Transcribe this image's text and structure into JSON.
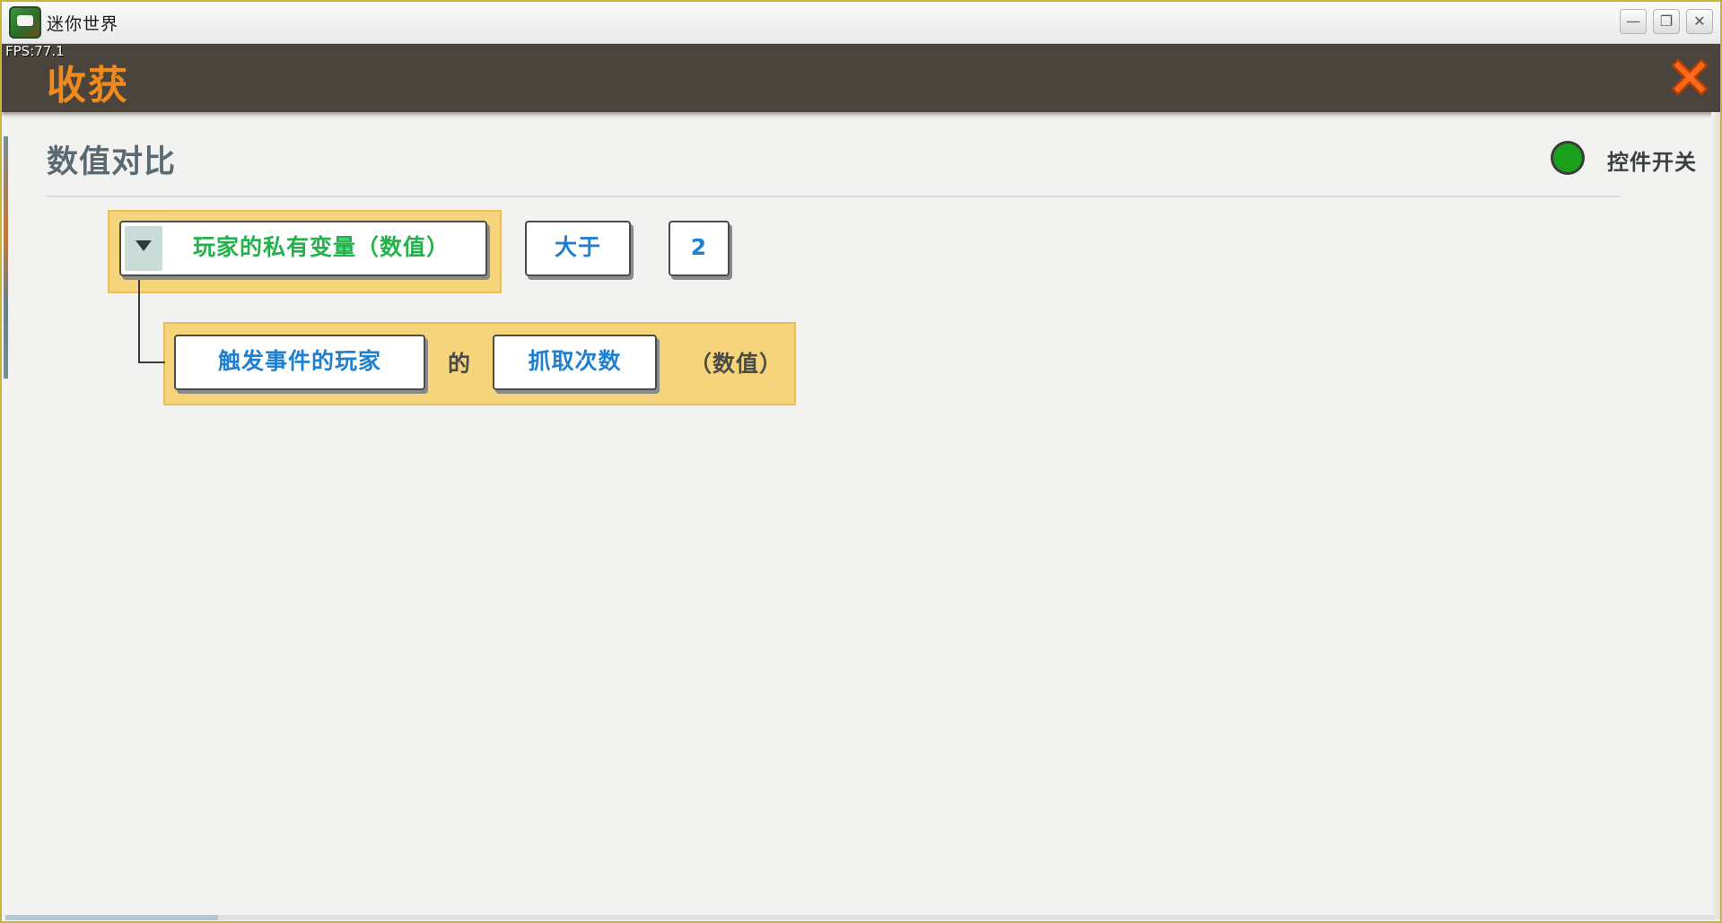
{
  "window": {
    "app_title": "迷你世界",
    "minimize_glyph": "—",
    "maximize_glyph": "❐",
    "close_glyph": "✕"
  },
  "fps": "FPS:77.1",
  "header": {
    "title": "收获",
    "close_icon": "close-x-icon",
    "accent_color": "#f08a1c"
  },
  "section": {
    "title": "数值对比",
    "toggle_label": "控件开关",
    "toggle_color": "#1aa01a"
  },
  "condition": {
    "left_operand": "玩家的私有变量（数值）",
    "operator": "大于",
    "right_operand": "2",
    "sub_expression": {
      "subject": "触发事件的玩家",
      "connector": "的",
      "attribute": "抓取次数",
      "type_label": "（数值）"
    }
  }
}
